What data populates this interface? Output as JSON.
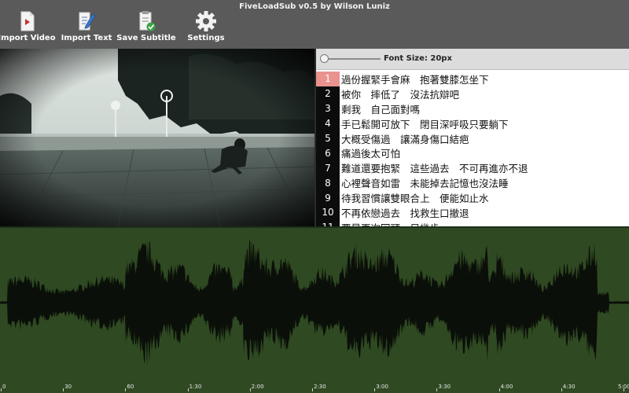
{
  "app_title": "FiveLoadSub v0.5 by Wilson Luniz",
  "toolbar": {
    "import_video": "Import Video",
    "import_text": "Import Text",
    "save_subtitle": "Save Subtitle",
    "settings": "Settings"
  },
  "font_size_label": "Font Size: 20px",
  "subtitles": [
    {
      "num": "1",
      "text": "過份握緊手會麻　抱著雙膝怎坐下",
      "active": true
    },
    {
      "num": "2",
      "text": "被你　摔低了　沒法抗辯吧"
    },
    {
      "num": "3",
      "text": "剩我　自己面對嗎"
    },
    {
      "num": "4",
      "text": "手已鬆開可放下　閉目深呼吸只要躺下"
    },
    {
      "num": "5",
      "text": "大概受傷過　讓滿身傷口結疤"
    },
    {
      "num": "6",
      "text": "痛過後太可怕"
    },
    {
      "num": "7",
      "text": "難道還要抱緊　這些過去　不可再進亦不退"
    },
    {
      "num": "8",
      "text": "心裡聲音如雷　未能掉去記憶也沒法睡"
    },
    {
      "num": "9",
      "text": "待我習慣讓雙眼合上　便能如止水"
    },
    {
      "num": "10",
      "text": "不再依戀過去　找救生口撤退"
    },
    {
      "num": "11",
      "text": "要是再次回頭　只幾步"
    }
  ],
  "timeline": {
    "ticks": [
      "0",
      "30",
      "60",
      "1:30",
      "2:00",
      "2:30",
      "3:00",
      "3:30",
      "4:00",
      "4:30",
      "5:00"
    ]
  },
  "colors": {
    "toolbar": "#5a5a5a",
    "active_line": "#e9928f",
    "waveform_bg": "#2f4a22",
    "waveform_fill": "#0b0f09"
  }
}
